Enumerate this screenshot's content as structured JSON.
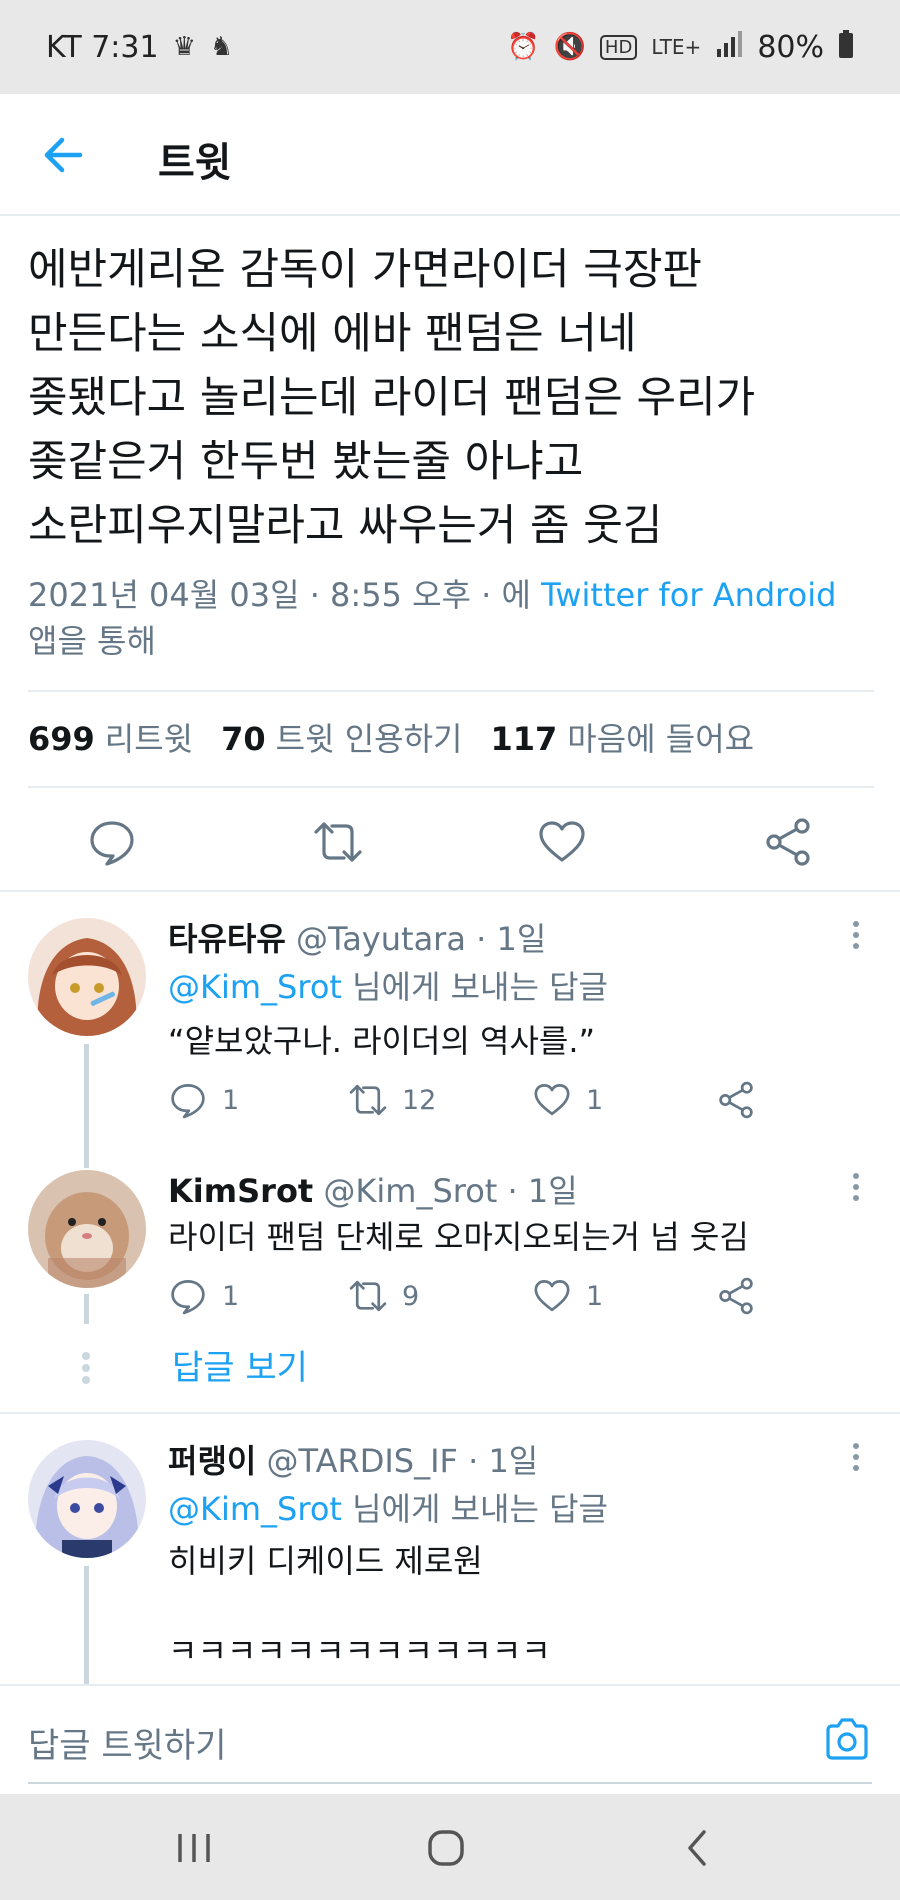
{
  "status_bar": {
    "carrier_time": "KT 7:31",
    "network": "LTE+",
    "battery": "80%"
  },
  "header": {
    "title": "트윗"
  },
  "tweet": {
    "text": "에반게리온 감독이 가면라이더 극장판\n만든다는 소식에 에바 팬덤은 너네\n좆됐다고 놀리는데 라이더 팬덤은 우리가\n좆같은거 한두번 봤는줄 아냐고\n소란피우지말라고 싸우는거 좀 웃김",
    "timestamp": "2021년 04월 03일 · 8:55 오후 · 에 ",
    "source": "Twitter for Android",
    "source_suffix": "앱을 통해",
    "stats": {
      "retweets_count": "699",
      "retweets_label": "리트윗",
      "quotes_count": "70",
      "quotes_label": "트윗 인용하기",
      "likes_count": "117",
      "likes_label": "마음에 들어요"
    }
  },
  "replies": [
    {
      "name": "타유타유",
      "handle": "@Tayutara · 1일",
      "reply_to_handle": "@Kim_Srot",
      "reply_to_suffix": " 님에게 보내는 답글",
      "text": "“얕보았구나. 라이더의 역사를.”",
      "replies": "1",
      "retweets": "12",
      "likes": "1",
      "avatar_color": "#c9805a"
    },
    {
      "name": "KimSrot",
      "handle": "@Kim_Srot · 1일",
      "text": "라이더 팬덤 단체로 오마지오되는거 넘 웃김",
      "replies": "1",
      "retweets": "9",
      "likes": "1",
      "avatar_color": "#c79b7a"
    },
    {
      "name": "퍼랭이",
      "handle": "@TARDIS_IF · 1일",
      "reply_to_handle": "@Kim_Srot",
      "reply_to_suffix": " 님에게 보내는 답글",
      "text": "히비키 디케이드 제로원",
      "text_extra": "ㅋㅋㅋㅋㅋㅋㅋㅋㅋㅋㅋㅋㅋ",
      "avatar_color": "#7f86c9"
    }
  ],
  "show_replies_label": "답글 보기",
  "compose": {
    "placeholder": "답글 트윗하기"
  },
  "colors": {
    "accent": "#1da1f2",
    "secondary_text": "#657786",
    "divider": "#e6ecf0"
  },
  "icons": [
    "back-arrow-icon",
    "reply-icon",
    "retweet-icon",
    "like-icon",
    "share-icon",
    "more-icon",
    "camera-icon",
    "recent-apps-icon",
    "home-icon",
    "nav-back-icon"
  ]
}
